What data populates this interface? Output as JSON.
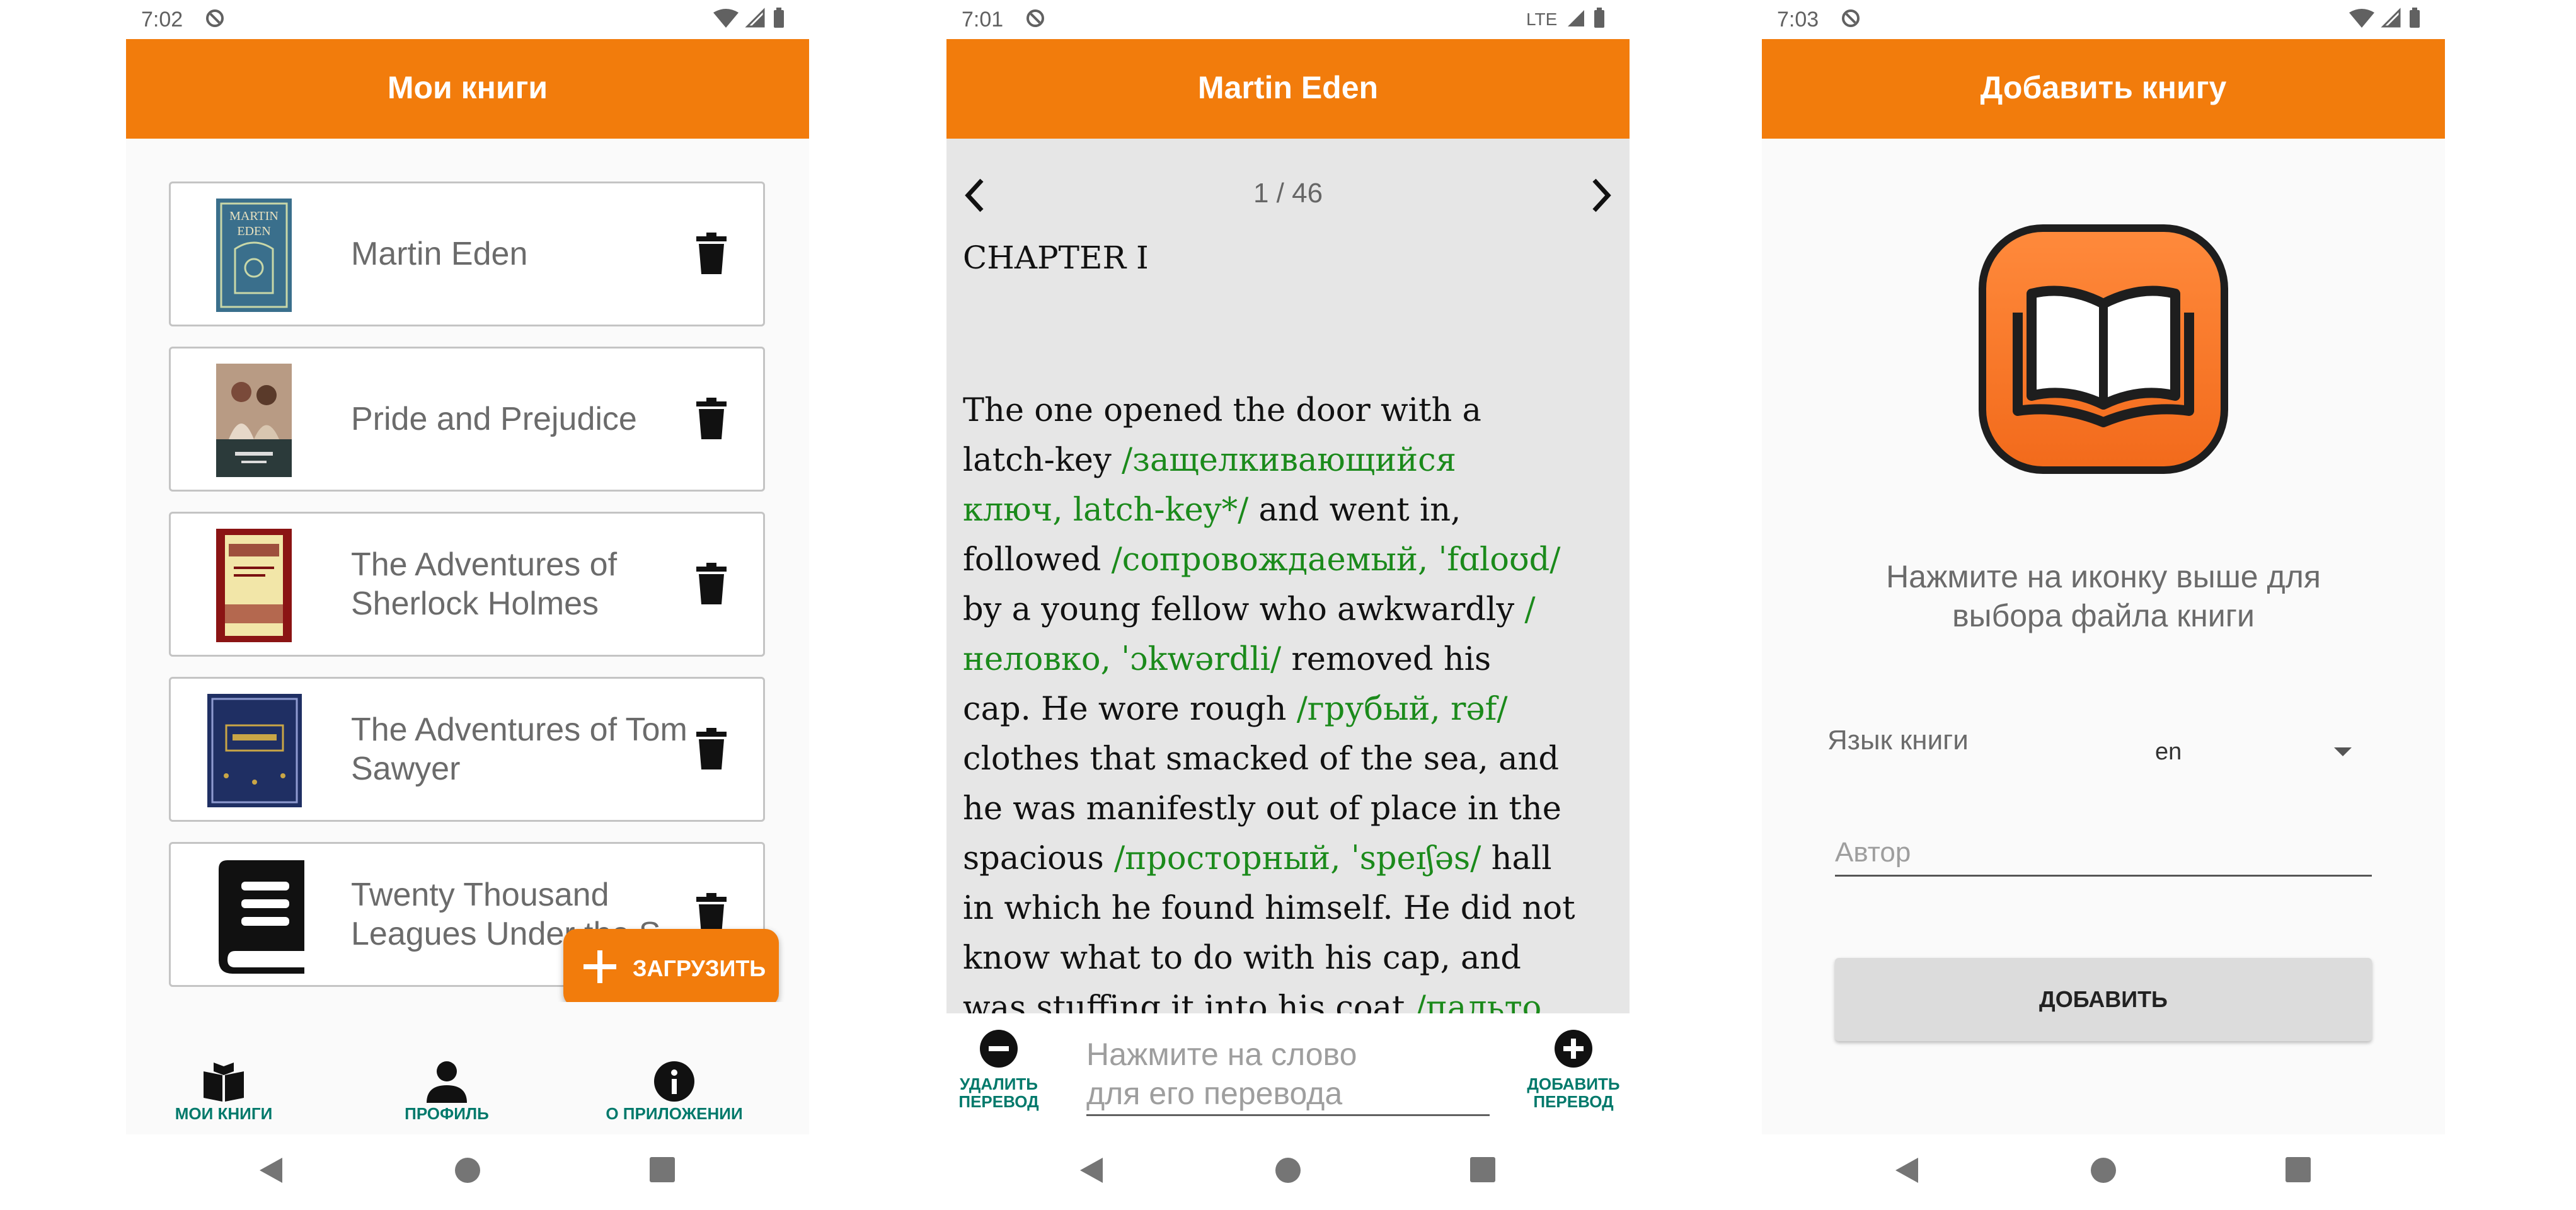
{
  "colors": {
    "accent": "#f27c0c",
    "nav_active": "#00796b",
    "translation": "#1b8a1b"
  },
  "screens": [
    {
      "status": {
        "time": "7:02",
        "network": "wifi"
      },
      "appbar": {
        "title": "Мои книги"
      },
      "books": [
        {
          "title": "Martin Eden",
          "cover": "martin-eden-cover"
        },
        {
          "title": "Pride and Prejudice",
          "cover": "pride-prejudice-cover"
        },
        {
          "title": "The Adventures of\nSherlock Holmes",
          "cover": "sherlock-cover"
        },
        {
          "title": "The Adventures of Tom\nSawyer",
          "cover": "tom-sawyer-cover"
        },
        {
          "title": "Twenty Thousand\nLeagues Under the S",
          "cover": "book-icon"
        }
      ],
      "fab": {
        "label": "ЗАГРУЗИТЬ"
      },
      "bottom_nav": [
        {
          "label": "МОИ КНИГИ",
          "icon": "book-open-icon",
          "active": true
        },
        {
          "label": "ПРОФИЛЬ",
          "icon": "person-icon",
          "active": true
        },
        {
          "label": "О ПРИЛОЖЕНИИ",
          "icon": "info-icon",
          "active": true
        }
      ]
    },
    {
      "status": {
        "time": "7:01",
        "network": "LTE"
      },
      "appbar": {
        "title": "Martin Eden"
      },
      "reader": {
        "page": "1 / 46",
        "chapter": "CHAPTER I",
        "paragraph": [
          {
            "t": "The one opened the door with a\nlatch-key ",
            "tr": false
          },
          {
            "t": "/защелкивающийся\nключ, latch-key*/",
            "tr": true
          },
          {
            "t": " and went in,\nfollowed ",
            "tr": false
          },
          {
            "t": "/сопровождаемый, ˈfɑloʊd/",
            "tr": true
          },
          {
            "t": "\nby a young fellow who awkwardly ",
            "tr": false
          },
          {
            "t": "/\nнеловко, ˈɔkwərdli/",
            "tr": true
          },
          {
            "t": " removed his\ncap. He wore rough ",
            "tr": false
          },
          {
            "t": "/грубый, rəf/",
            "tr": true
          },
          {
            "t": "\nclothes that smacked of the sea, and\nhe was manifestly out of place in the\nspacious ",
            "tr": false
          },
          {
            "t": "/просторный, ˈspeɪʃəs/",
            "tr": true
          },
          {
            "t": " hall\nin which he found himself. He did not\nknow what to do with his cap, and\nwas stuffing it into his coat ",
            "tr": false
          },
          {
            "t": "/пальто",
            "tr": true
          }
        ]
      },
      "translate_bar": {
        "remove_label": "УДАЛИТЬ\nПЕРЕВОД",
        "hint": "Нажмите на слово\nдля его перевода",
        "add_label": "ДОБАВИТЬ\nПЕРЕВОД"
      }
    },
    {
      "status": {
        "time": "7:03",
        "network": "wifi"
      },
      "appbar": {
        "title": "Добавить книгу"
      },
      "hint": "Нажмите на иконку выше для\nвыбора файла книги",
      "language_label": "Язык книги",
      "language_value": "en",
      "author_placeholder": "Автор",
      "add_button": "ДОБАВИТЬ"
    }
  ]
}
